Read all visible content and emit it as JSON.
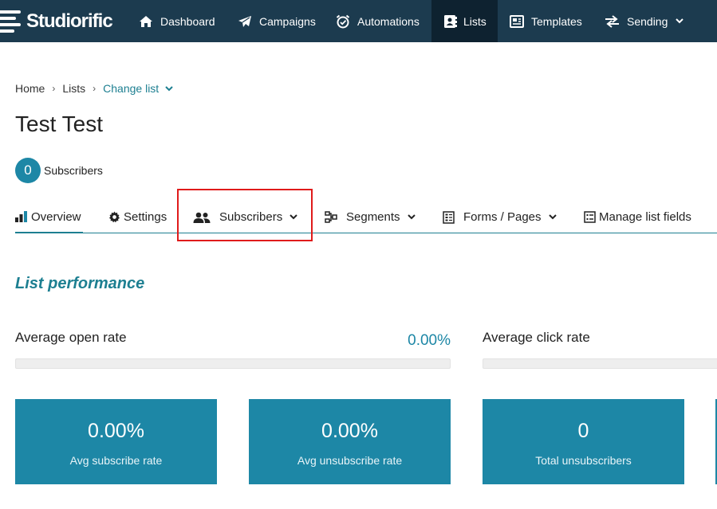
{
  "app": {
    "brand": "Studiorific"
  },
  "nav": {
    "items": [
      {
        "label": "Dashboard",
        "icon": "home-icon"
      },
      {
        "label": "Campaigns",
        "icon": "paper-plane-icon"
      },
      {
        "label": "Automations",
        "icon": "alarm-clock-icon"
      },
      {
        "label": "Lists",
        "icon": "address-book-icon",
        "active": true
      },
      {
        "label": "Templates",
        "icon": "newspaper-icon"
      },
      {
        "label": "Sending",
        "icon": "exchange-arrows-icon",
        "dropdown": true
      }
    ]
  },
  "breadcrumb": {
    "home": "Home",
    "lists": "Lists",
    "change": "Change list"
  },
  "list": {
    "title": "Test Test",
    "subscriber_count": "0",
    "subscriber_label": "Subscribers"
  },
  "tabs": [
    {
      "label": "Overview",
      "icon": "bar-chart-icon",
      "active": true
    },
    {
      "label": "Settings",
      "icon": "gear-icon"
    },
    {
      "label": "Subscribers",
      "icon": "users-icon",
      "dropdown": true
    },
    {
      "label": "Segments",
      "icon": "segments-icon",
      "dropdown": true
    },
    {
      "label": "Forms / Pages",
      "icon": "form-icon",
      "dropdown": true
    },
    {
      "label": "Manage list fields",
      "icon": "fields-table-icon"
    }
  ],
  "performance": {
    "title": "List performance",
    "open_rate": {
      "label": "Average open rate",
      "value": "0.00%",
      "fraction": 0
    },
    "click_rate": {
      "label": "Average click rate",
      "fraction": 0
    }
  },
  "stats": [
    {
      "value": "0.00%",
      "label": "Avg subscribe rate"
    },
    {
      "value": "0.00%",
      "label": "Avg unsubscribe rate"
    },
    {
      "value": "0",
      "label": "Total unsubscribers"
    }
  ],
  "colors": {
    "nav_bg": "#1c3b4f",
    "nav_active": "#0e2230",
    "accent": "#1d87a6",
    "link": "#1d7f91",
    "highlight": "#e01b1b"
  }
}
